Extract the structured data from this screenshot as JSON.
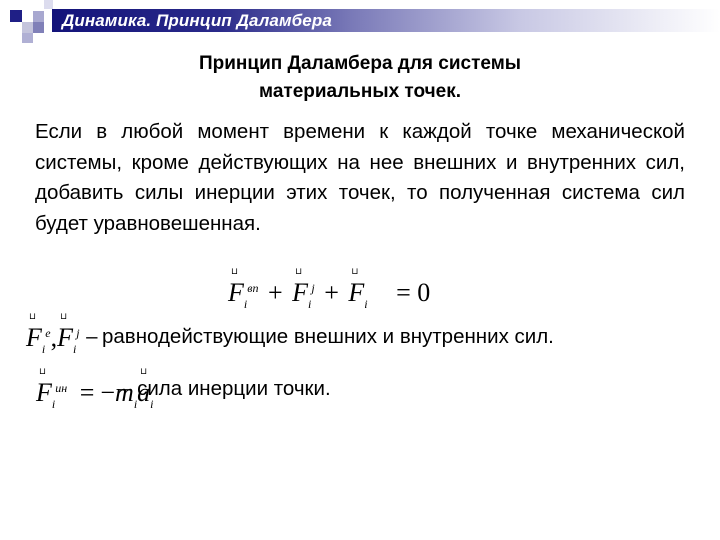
{
  "header": {
    "title": "Динамика. Принцип Даламбера",
    "bar_color_start": "#13137a",
    "bar_color_end": "#ffffff"
  },
  "slide": {
    "title_line1": "Принцип Даламбера для системы",
    "title_line2": "материальных точек.",
    "body": "Если в любой момент времени к каждой точке механической системы, кроме действующих на нее внешних и внутренних сил, добавить силы инерции этих точек, то полученная система сил будет уравновешенная.",
    "equation": {
      "term1": {
        "symbol": "F",
        "sub": "i",
        "sup": "вп"
      },
      "term2": {
        "symbol": "F",
        "sub": "i",
        "sup": "j"
      },
      "term3": {
        "symbol": "F",
        "sub": "i",
        "sup": ""
      },
      "plus": "+",
      "rhs": "= 0"
    },
    "definition1": {
      "term1": {
        "symbol": "F",
        "sub": "i",
        "sup": "e"
      },
      "comma": ",",
      "term2": {
        "symbol": "F",
        "sub": "i",
        "sup": "j"
      },
      "dash": "–",
      "text": "равнодействующие внешних и внутренних сил."
    },
    "definition2": {
      "term": {
        "symbol": "F",
        "sub": "i",
        "sup": "ин"
      },
      "formula": "= −m a",
      "eq": "=",
      "minus": "−",
      "m": "m",
      "a": "a",
      "sub": "i",
      "text": "– сила инерции точки."
    }
  }
}
